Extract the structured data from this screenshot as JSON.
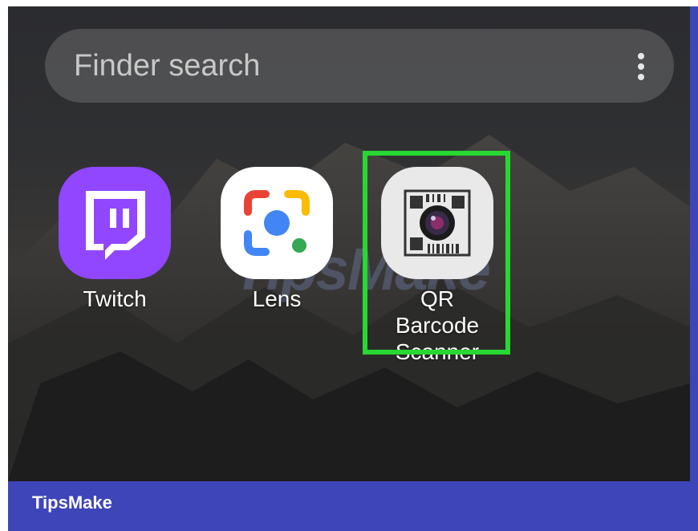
{
  "search": {
    "placeholder": "Finder search"
  },
  "apps": [
    {
      "label": "Twitch",
      "icon": "twitch-icon"
    },
    {
      "label": "Lens",
      "icon": "lens-icon"
    },
    {
      "label": "QR Barcode\nScanner",
      "icon": "qr-barcode-scanner-icon"
    }
  ],
  "watermark": "TipsMake",
  "footer": {
    "brand": "TipsMake"
  },
  "colors": {
    "frame": "#3e45b8",
    "highlight": "#27d832",
    "twitch": "#9146ff"
  }
}
